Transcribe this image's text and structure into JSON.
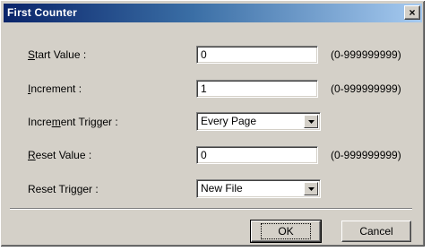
{
  "window": {
    "title": "First Counter",
    "close_label": "×"
  },
  "fields": {
    "start_value": {
      "label_pre": "",
      "label_ul": "S",
      "label_post": "tart Value :",
      "value": "0",
      "range": "(0-999999999)"
    },
    "increment": {
      "label_pre": "",
      "label_ul": "I",
      "label_post": "ncrement :",
      "value": "1",
      "range": "(0-999999999)"
    },
    "increment_trigger": {
      "label_pre": "Incre",
      "label_ul": "m",
      "label_post": "ent Trigger :",
      "value": "Every Page"
    },
    "reset_value": {
      "label_pre": "",
      "label_ul": "R",
      "label_post": "eset Value :",
      "value": "0",
      "range": "(0-999999999)"
    },
    "reset_trigger": {
      "label_pre": "Reset Tri",
      "label_ul": "g",
      "label_post": "ger :",
      "value": "New File"
    }
  },
  "buttons": {
    "ok": "OK",
    "cancel": "Cancel"
  },
  "icons": {
    "close": "close-icon",
    "dropdown": "chevron-down-icon"
  }
}
